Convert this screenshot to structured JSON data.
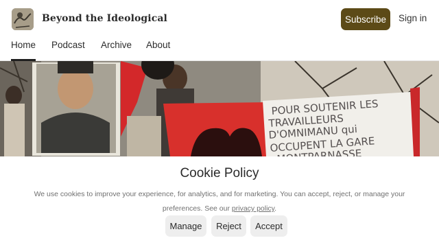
{
  "header": {
    "publication_title": "Beyond the Ideological",
    "subscribe_label": "Subscribe",
    "signin_label": "Sign in",
    "accent_color": "#5c4a17"
  },
  "nav": {
    "items": [
      {
        "label": "Home",
        "active": true
      },
      {
        "label": "Podcast",
        "active": false
      },
      {
        "label": "Archive",
        "active": false
      },
      {
        "label": "About",
        "active": false
      }
    ]
  },
  "hero": {
    "banner_text_lines": [
      "POUR SOUTENIR LES",
      "TRAVAILLEURS",
      "D'OMNIMANU qui",
      "OCCUPENT LA GARE",
      "MONTPARNASSE"
    ]
  },
  "cookie_banner": {
    "title": "Cookie Policy",
    "text_before_link": "We use cookies to improve your experience, for analytics, and for marketing. You can accept, reject, or manage your preferences. See our ",
    "link_text": "privacy policy",
    "text_after_link": ".",
    "buttons": {
      "manage": "Manage",
      "reject": "Reject",
      "accept": "Accept"
    }
  }
}
